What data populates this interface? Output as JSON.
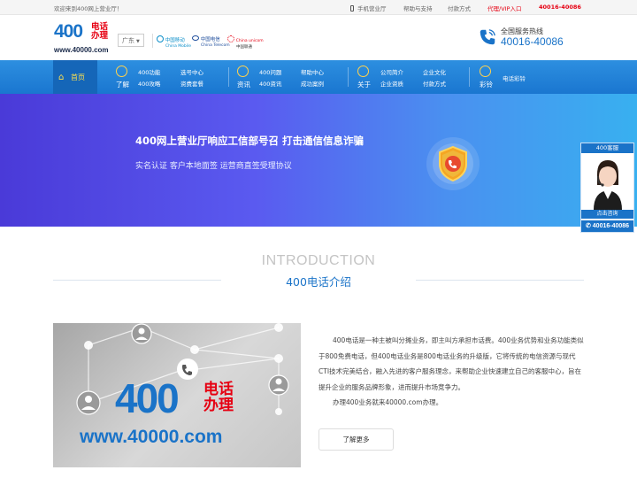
{
  "topbar": {
    "welcome": "欢迎来到400网上营业厅！",
    "links": [
      "手机营业厅",
      "帮助与支持",
      "付款方式",
      "代理/VIP入口"
    ],
    "phone": "40016-40086"
  },
  "header": {
    "logo_number": "400",
    "logo_cn": "电话办理",
    "logo_url": "www.40000.com",
    "city": "广东",
    "carriers": {
      "mobile_cn": "中国移动",
      "mobile_en": "China Mobile",
      "telecom_cn": "中国电信",
      "telecom_en": "China Telecom",
      "unicom_cn": "中国联通",
      "unicom_en": "China unicom"
    },
    "hotline_label": "全国服务热线",
    "hotline_number": "40016-40086"
  },
  "nav": {
    "home": "首页",
    "groups": [
      {
        "title": "了解",
        "items": [
          "400功能",
          "选号中心",
          "400攻略",
          "资费套餐"
        ]
      },
      {
        "title": "资讯",
        "items": [
          "400问题",
          "帮助中心",
          "400资讯",
          "成功案例"
        ]
      },
      {
        "title": "关于",
        "items": [
          "公司简介",
          "企业文化",
          "企业资质",
          "付款方式"
        ]
      },
      {
        "title": "彩铃",
        "items": [
          "电话彩铃"
        ]
      }
    ]
  },
  "banner": {
    "headline": "400网上营业厅响应工信部号召  打击通信信息诈骗",
    "subline": "实名认证  客户本地面签  运营商直签受理协议",
    "slides": 3,
    "active_slide": 2
  },
  "service_float": {
    "title": "400客服",
    "link": "点击咨询",
    "phone": "40016-40086"
  },
  "intro": {
    "title_en": "INTRODUCTION",
    "title_cn": "400电话介绍",
    "image_number": "400",
    "image_cn": "电话办理",
    "image_url": "www.40000.com",
    "paragraph1": "400电话是一种主被叫分摊业务，即主叫方承担市话费。400业务优势和业务功能类似于800免费电话，但400电话业务是800电话业务的升级版，它将传统的电信资源与现代CTI技术完美结合，融入先进的客户服务理念，来帮助企业快速建立自己的客服中心，旨在提升企业的服务品牌形象，进而提升市场竞争力。",
    "paragraph2": "办理400业务就来40000.com办理。",
    "more_button": "了解更多"
  },
  "colors": {
    "brand_blue": "#1a73c8",
    "brand_red": "#e60012",
    "nav_bg": "#2587dc"
  }
}
